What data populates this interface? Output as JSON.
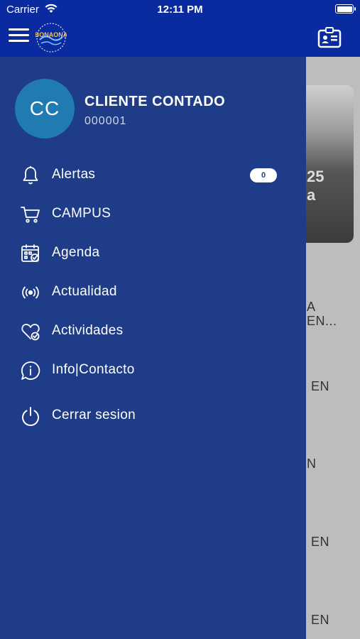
{
  "status_bar": {
    "carrier": "Carrier",
    "time": "12:11 PM"
  },
  "app_bar": {
    "logo_text": "BONAONA"
  },
  "user": {
    "initials": "CC",
    "name": "CLIENTE CONTADO",
    "code": "000001"
  },
  "menu": {
    "items": [
      {
        "label": "Alertas",
        "icon": "bell-icon",
        "badge": "0"
      },
      {
        "label": "CAMPUS",
        "icon": "cart-icon"
      },
      {
        "label": "Agenda",
        "icon": "calendar-check-icon"
      },
      {
        "label": "Actualidad",
        "icon": "broadcast-icon"
      },
      {
        "label": "Actividades",
        "icon": "heart-check-icon"
      },
      {
        "label": "Info|Contacto",
        "icon": "info-chat-icon"
      },
      {
        "label": "Cerrar sesion",
        "icon": "power-icon"
      }
    ]
  },
  "background_page": {
    "card_text_1": "25",
    "card_text_2": "a",
    "items": [
      "A",
      "EN...",
      "EN",
      "N",
      "EN",
      "EN"
    ]
  },
  "colors": {
    "appbar": "#0a2aa0",
    "drawer": "#1e3c87",
    "avatar": "#1f7bb0",
    "overlay_page": "#bdbdbd"
  }
}
